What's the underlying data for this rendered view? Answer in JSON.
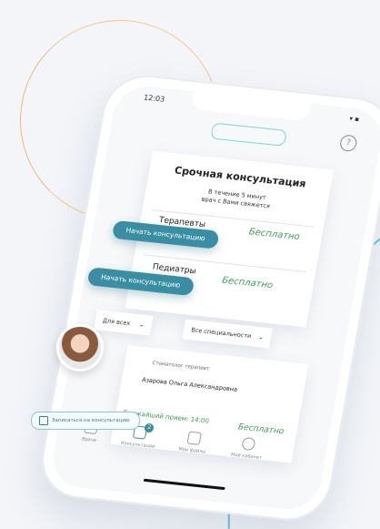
{
  "status": {
    "time": "12:03",
    "icons": "▾ ▪"
  },
  "header": {
    "logo_text": "",
    "help_icon": "?"
  },
  "urgent": {
    "title": "Срочная консультация",
    "subtitle_line1": "В течение 5 минут",
    "subtitle_line2": "врач с Вами свяжется",
    "rows": [
      {
        "name": "Терапевты",
        "price": "Бесплатно",
        "button": "Начать консультацию"
      },
      {
        "name": "Педиатры",
        "price": "Бесплатно",
        "button": "Начать консультацию"
      }
    ]
  },
  "filters": {
    "audience": "Для всех",
    "speciality": "Все специальности"
  },
  "doctor": {
    "role": "Стоматолог терапевт",
    "name": "Азарова Ольга Александровна",
    "next_label": "Ближайший прием: 14:00",
    "price": "Бесплатно",
    "signup": "Записаться на консультацию"
  },
  "tabbar": {
    "items": [
      {
        "label": "Врачи"
      },
      {
        "label": "Консультации",
        "badge": "2"
      },
      {
        "label": "Мои файлы"
      },
      {
        "label": "Мой кабинет"
      }
    ]
  }
}
